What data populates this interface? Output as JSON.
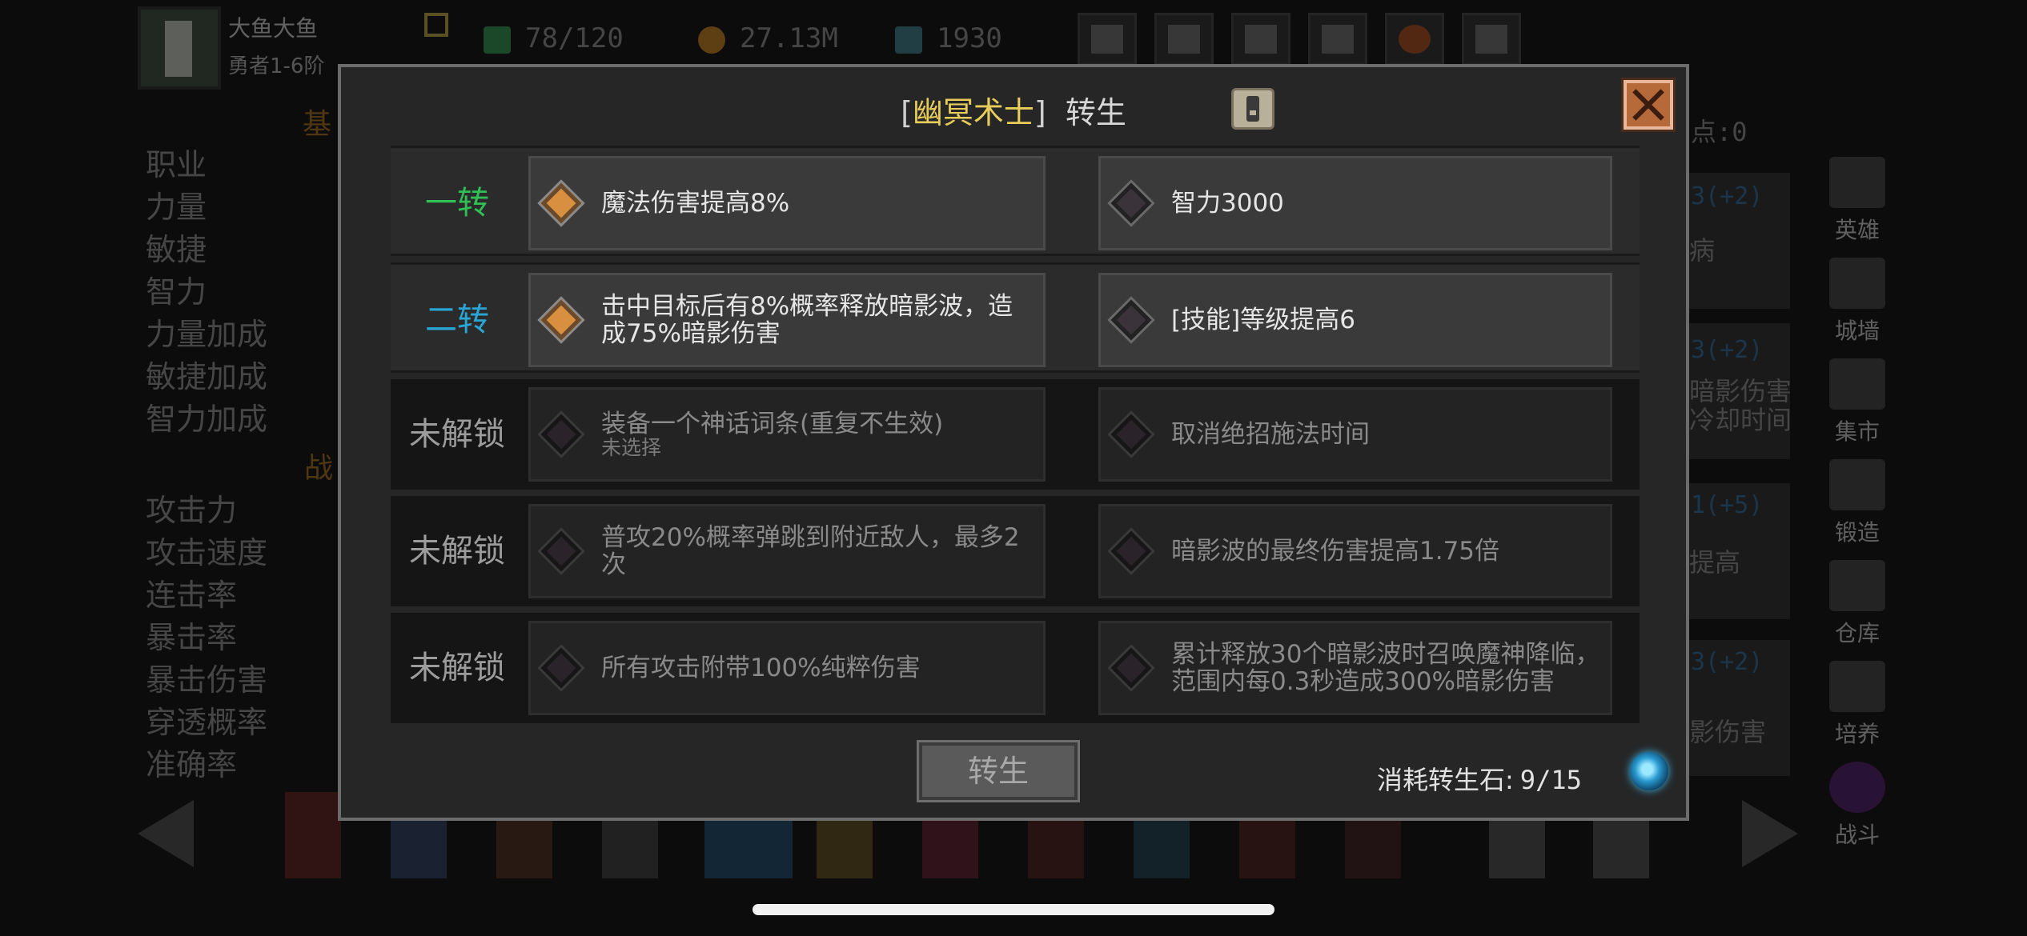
{
  "player": {
    "name": "大鱼大鱼",
    "rank": "勇者1-6阶"
  },
  "resources": [
    {
      "icon": "energy-icon",
      "value": "78/120",
      "color": "#3aa05a"
    },
    {
      "icon": "gold-coin-icon",
      "value": "27.13M",
      "color": "#d08a2a"
    },
    {
      "icon": "gem-icon",
      "value": "1930",
      "color": "#4a8a9a"
    }
  ],
  "top_buttons": [
    "shop-cart-icon",
    "mail-icon",
    "gamepad-icon",
    "settings-gear-icon",
    "color-wheel-icon",
    "spider-web-icon"
  ],
  "background": {
    "section_basic": "基",
    "section_battle": "战",
    "basic_stats": [
      "职业",
      "力量",
      "敏捷",
      "智力",
      "力量加成",
      "敏捷加成",
      "智力加成"
    ],
    "battle_stats": [
      "攻击力",
      "攻击速度",
      "连击率",
      "暴击率",
      "暴击伤害",
      "穿透概率",
      "准确率"
    ],
    "points_label": "点:0",
    "right_texts": [
      "病",
      "暗影伤害",
      "冷却时间",
      "提高",
      "影伤害"
    ],
    "right_plus": [
      "3(+2)",
      "3(+2)",
      "1(+5)",
      "3(+2)"
    ],
    "nav": [
      "英雄",
      "城墙",
      "集市",
      "锻造",
      "仓库",
      "培养",
      "战斗"
    ]
  },
  "modal": {
    "title_open": "[",
    "class_name": "幽冥术士",
    "title_close": "]",
    "title_suffix": "转生",
    "rows": [
      {
        "label": "一转",
        "left": "魔法伤害提高8%",
        "left_sub": "",
        "right": "智力3000"
      },
      {
        "label": "二转",
        "left": "击中目标后有8%概率释放暗影波，造成75%暗影伤害",
        "left_sub": "",
        "right": "[技能]等级提高6"
      },
      {
        "label": "未解锁",
        "left": "装备一个神话词条(重复不生效)",
        "left_sub": "未选择",
        "right": "取消绝招施法时间"
      },
      {
        "label": "未解锁",
        "left": "普攻20%概率弹跳到附近敌人，最多2次",
        "left_sub": "",
        "right": "暗影波的最终伤害提高1.75倍"
      },
      {
        "label": "未解锁",
        "left": "所有攻击附带100%纯粹伤害",
        "left_sub": "",
        "right": "累计释放30个暗影波时召唤魔神降临，范围内每0.3秒造成300%暗影伤害"
      }
    ],
    "rebirth_button": "转生",
    "cost_label": "消耗转生石:",
    "cost_value": "9/15"
  }
}
